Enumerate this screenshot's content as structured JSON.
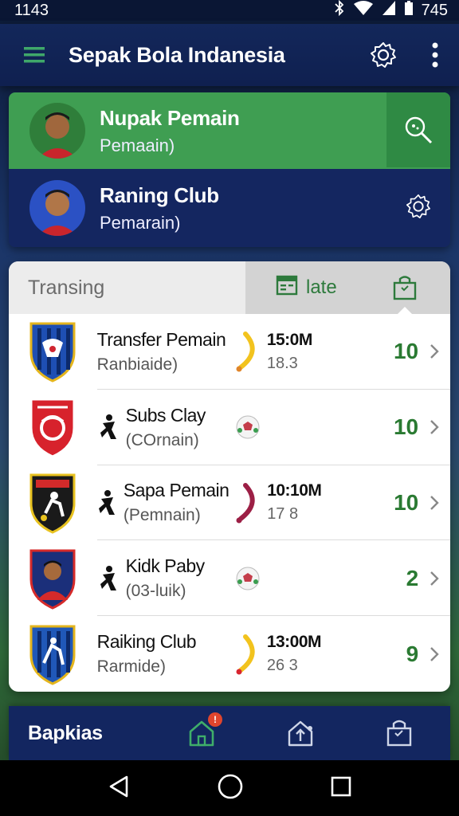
{
  "status": {
    "time": "1143",
    "battery": "745"
  },
  "appbar": {
    "title": "Sepak Bola Indanesia"
  },
  "cards": [
    {
      "name": "Nupak Pemain",
      "sub": "Pemaain)"
    },
    {
      "name": "Raning Club",
      "sub": "Pemarain)"
    }
  ],
  "tabs": {
    "first": "Transing",
    "second": "late"
  },
  "rows": [
    {
      "label": "Transfer Pemain",
      "sub": "Ranbiaide)",
      "fee": "15:0M",
      "fee2": "18.3",
      "score": "10"
    },
    {
      "label": "Subs Clay",
      "sub": "(COrnain)",
      "fee": "",
      "fee2": "",
      "score": "10"
    },
    {
      "label": "Sapa Pemain",
      "sub": "(Pemnain)",
      "fee": "10:10M",
      "fee2": "17 8",
      "score": "10"
    },
    {
      "label": "Kidk Paby",
      "sub": "(03-luik)",
      "fee": "",
      "fee2": "",
      "score": "2"
    },
    {
      "label": "Raiking Club",
      "sub": "Rarmide)",
      "fee": "13:00M",
      "fee2": "26 3",
      "score": "9"
    }
  ],
  "bottomnav": {
    "label": "Bapkias",
    "badge": "!"
  },
  "colors": {
    "accent_green": "#3f9e52",
    "navy": "#142660",
    "score_green": "#2a7a32"
  },
  "icons": [
    "menu-icon",
    "gear-icon",
    "more-icon",
    "search-player-icon",
    "home-icon",
    "upload-icon",
    "bag-icon",
    "calendar-icon"
  ]
}
